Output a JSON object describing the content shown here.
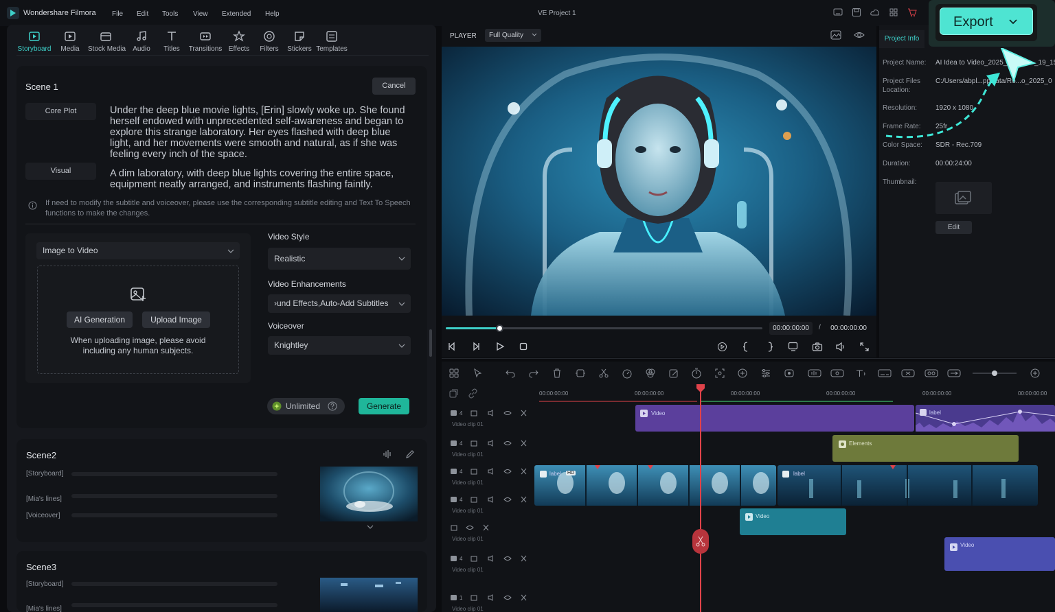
{
  "app": {
    "name": "Wondershare Filmora",
    "window_title": "VE Project 1"
  },
  "menu": [
    "File",
    "Edit",
    "Tools",
    "View",
    "Extended",
    "Help"
  ],
  "nav": [
    {
      "label": "Storyboard",
      "icon": "storyboard-icon"
    },
    {
      "label": "Media",
      "icon": "media-icon"
    },
    {
      "label": "Stock Media",
      "icon": "stock-media-icon"
    },
    {
      "label": "Audio",
      "icon": "audio-icon"
    },
    {
      "label": "Titles",
      "icon": "titles-icon"
    },
    {
      "label": "Transitions",
      "icon": "transitions-icon"
    },
    {
      "label": "Effects",
      "icon": "effects-icon"
    },
    {
      "label": "Filters",
      "icon": "filters-icon"
    },
    {
      "label": "Stickers",
      "icon": "stickers-icon"
    },
    {
      "label": "Templates",
      "icon": "templates-icon"
    }
  ],
  "scene1": {
    "title": "Scene 1",
    "cancel": "Cancel",
    "core_plot_label": "Core Plot",
    "core_plot_text": "Under the deep blue movie lights, [Erin] slowly woke up. She found herself endowed with unprecedented self-awareness and began to explore this strange laboratory. Her eyes flashed with deep blue light, and her movements were smooth and natural, as if she was feeling every inch of the space.",
    "visual_label": "Visual",
    "visual_text": "A dim laboratory, with deep blue lights covering the entire space, equipment neatly arranged, and instruments flashing faintly.",
    "note": "If need to modify the subtitle and voiceover, please use the corresponding subtitle editing and Text To Speech functions to make the changes.",
    "mode_select": "Image to Video",
    "ai_generation": "AI Generation",
    "upload_image": "Upload Image",
    "upload_hint": "When uploading image, please avoid including any human subjects.",
    "video_style_label": "Video Style",
    "video_style_value": "Realistic",
    "enhancements_label": "Video Enhancements",
    "enhancements_value": "›und Effects,Auto-Add Subtitles",
    "voiceover_label": "Voiceover",
    "voiceover_value": "Knightley",
    "unlimited": "Unlimited",
    "generate": "Generate"
  },
  "scene2": {
    "title": "Scene2",
    "storyboard": "[Storyboard]",
    "mias_lines": "[Mia's lines]",
    "voiceover": "[Voiceover]"
  },
  "scene3": {
    "title": "Scene3",
    "storyboard": "[Storyboard]",
    "mias_lines": "[Mia's lines]"
  },
  "player": {
    "label": "PLAYER",
    "quality": "Full Quality",
    "time_current": "00:00:00:00",
    "time_sep": "/",
    "time_total": "00:00:00:00",
    "progress": 0.17
  },
  "project_info": {
    "tab": "Project Info",
    "rows": [
      {
        "key": "Project Name:",
        "value": "AI Idea to Video_2025_"
      },
      {
        "key": "Project Files Location:",
        "value": "C:/Users/abpl...ppData/Ro...o_2025_0"
      },
      {
        "key": "Resolution:",
        "value": "1920 x 1080"
      },
      {
        "key": "Frame Rate:",
        "value": "25fr"
      },
      {
        "key": "Color Space:",
        "value": "SDR - Rec.709"
      },
      {
        "key": "Duration:",
        "value": "00:00:24:00"
      },
      {
        "key": "Thumbnail:",
        "value": ""
      }
    ],
    "name_suffix": "_19_15",
    "edit": "Edit"
  },
  "export": {
    "label": "Export"
  },
  "timeline": {
    "ruler": [
      "00:00:00:00",
      "00:00:00:00",
      "00:00:00:00",
      "00:00:00:00",
      "00:00:00:00",
      "00:00:00:00"
    ],
    "track_label": "Video clip 01",
    "clips": {
      "video": "Video",
      "label": "label",
      "elements": "Elements",
      "hd": "HD"
    }
  },
  "colors": {
    "accent": "#3ed0c9",
    "generate": "#1fb69a",
    "video_clip": "#5b3f9c",
    "elements_clip": "#6e7a3b",
    "teal_clip": "#1f7f93",
    "blue_clip": "#4a4fb0",
    "playhead": "#e0424a"
  }
}
